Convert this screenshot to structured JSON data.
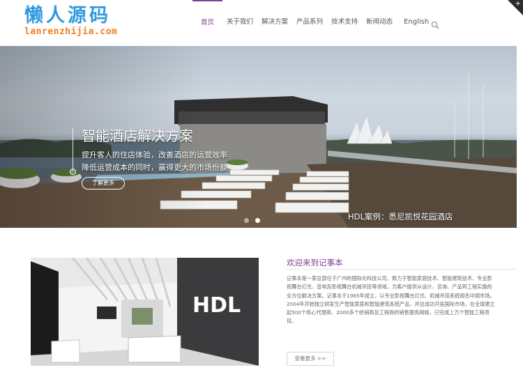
{
  "logo": {
    "cn": "懒人源码",
    "en": "lanrenzhijia.com"
  },
  "nav": [
    {
      "label": "首页",
      "active": true
    },
    {
      "label": "关于我们"
    },
    {
      "label": "解决方案"
    },
    {
      "label": "产品系列"
    },
    {
      "label": "技术支持"
    },
    {
      "label": "新闻动态"
    },
    {
      "label": "English"
    }
  ],
  "search": {
    "icon": "search-icon"
  },
  "corner": {
    "icon": "plus-icon",
    "symbol": "+"
  },
  "hero": {
    "title": "智能酒店解决方案",
    "line1": "提升客人的住店体验，改善酒店的运营效率",
    "line2": "降低运营成本的同时，赢得更大的市场份额",
    "button": "了解更多",
    "caption": "HDL案例：悉尼凯悦花园酒店",
    "slide_count": 2,
    "active_slide": 1
  },
  "about": {
    "title": "欢迎来到记事本",
    "body": "记事本是一家总部位于广州的国际化科技公司，致力于智能家居技术、智能建筑技术、专业影视舞台灯光、音响及影视舞台机械吊挂等领域，为客户提供从设计、咨询、产品到工程实施的全方位解决方案。记事本于1985年成立，以专业影视舞台灯光、机械吊挂系统闻名中国市场。2004年开始独立研发生产智能家居和智能建筑系统产品，并且成功开拓国际市场，在全球建立起500个核心代理商、2000多个经销商及工程商的销售服务网络，已完成上万个智能工程项目。",
    "button": "查看更多 >>",
    "sign": "HDL"
  },
  "colors": {
    "accent": "#7e3f98",
    "logo_blue": "#2f9ae0",
    "logo_orange": "#f07d1a"
  }
}
